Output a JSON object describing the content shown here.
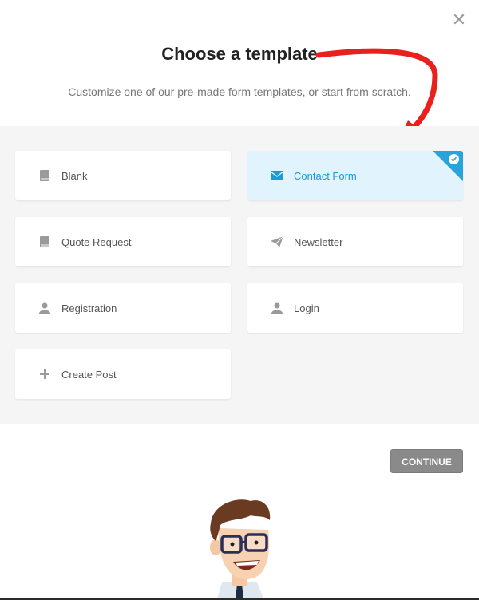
{
  "dialog": {
    "title": "Choose a template",
    "subtitle": "Customize one of our pre-made form templates, or start from scratch.",
    "close_icon": "close-icon"
  },
  "templates": [
    {
      "label": "Blank",
      "icon": "book-icon",
      "selected": false
    },
    {
      "label": "Contact Form",
      "icon": "envelope-icon",
      "selected": true
    },
    {
      "label": "Quote Request",
      "icon": "book-icon",
      "selected": false
    },
    {
      "label": "Newsletter",
      "icon": "paper-plane-icon",
      "selected": false
    },
    {
      "label": "Registration",
      "icon": "user-icon",
      "selected": false
    },
    {
      "label": "Login",
      "icon": "user-icon",
      "selected": false
    },
    {
      "label": "Create Post",
      "icon": "plus-icon",
      "selected": false
    }
  ],
  "footer": {
    "continue_label": "CONTINUE"
  },
  "colors": {
    "accent": "#2aa3dc",
    "selected_bg": "#e1f3fc",
    "button_bg": "#8a8a8a",
    "arrow": "#e8211c"
  }
}
